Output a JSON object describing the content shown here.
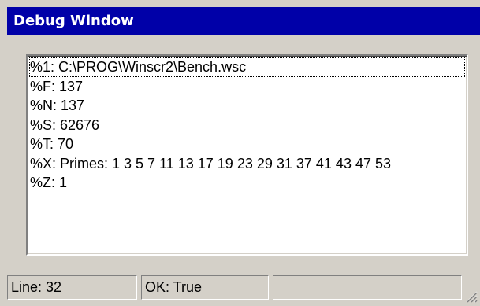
{
  "window": {
    "title": "Debug Window"
  },
  "debug_list": {
    "items": [
      "%1: C:\\PROG\\Winscr2\\Bench.wsc",
      "%F: 137",
      "%N: 137",
      "%S: 62676",
      "%T: 70",
      "%X: Primes: 1 3 5 7 11 13 17 19 23 29 31 37 41 43 47 53",
      "%Z: 1"
    ]
  },
  "statusbar": {
    "line": "Line: 32",
    "ok": "OK: True",
    "extra": ""
  },
  "colors": {
    "titlebar": "#0000a8",
    "face": "#d4d0c8"
  },
  "icons": {
    "grip": "resize-grip-icon"
  }
}
